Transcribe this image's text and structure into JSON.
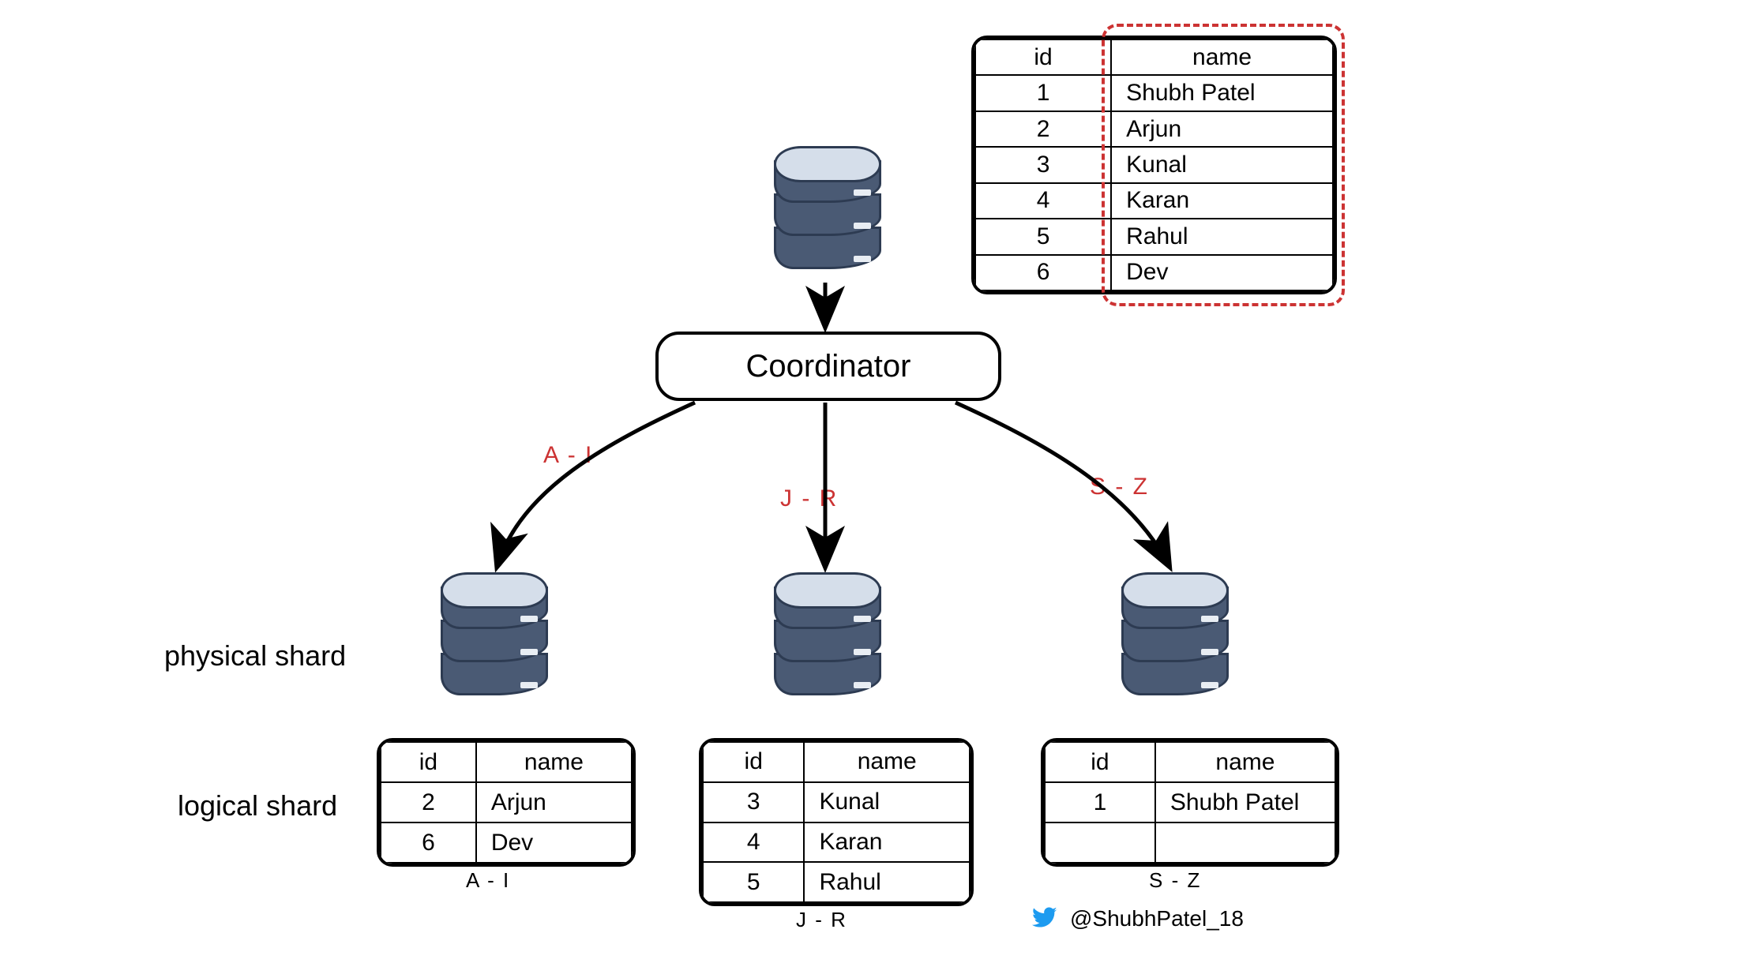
{
  "coordinator_label": "Coordinator",
  "range_labels": {
    "left": "A - I",
    "mid": "J - R",
    "right": "S - Z"
  },
  "side_labels": {
    "physical": "physical shard",
    "logical": "logical shard"
  },
  "captions": {
    "left": "A - I",
    "mid": "J - R",
    "right": "S - Z"
  },
  "credit": {
    "handle": "@ShubhPatel_18"
  },
  "main_table": {
    "headers": [
      "id",
      "name"
    ],
    "rows": [
      {
        "id": "1",
        "name": "Shubh Patel"
      },
      {
        "id": "2",
        "name": "Arjun"
      },
      {
        "id": "3",
        "name": "Kunal"
      },
      {
        "id": "4",
        "name": "Karan"
      },
      {
        "id": "5",
        "name": "Rahul"
      },
      {
        "id": "6",
        "name": "Dev"
      }
    ]
  },
  "shards": {
    "left": {
      "headers": [
        "id",
        "name"
      ],
      "rows": [
        {
          "id": "2",
          "name": "Arjun"
        },
        {
          "id": "6",
          "name": "Dev"
        }
      ]
    },
    "mid": {
      "headers": [
        "id",
        "name"
      ],
      "rows": [
        {
          "id": "3",
          "name": "Kunal"
        },
        {
          "id": "4",
          "name": "Karan"
        },
        {
          "id": "5",
          "name": "Rahul"
        }
      ]
    },
    "right": {
      "headers": [
        "id",
        "name"
      ],
      "rows": [
        {
          "id": "1",
          "name": "Shubh Patel"
        }
      ],
      "blank_rows": 1
    }
  },
  "colors": {
    "accent_red": "#cc3333",
    "db_body": "#4a5a74",
    "db_top": "#d5deea",
    "twitter": "#1d9bf0"
  }
}
